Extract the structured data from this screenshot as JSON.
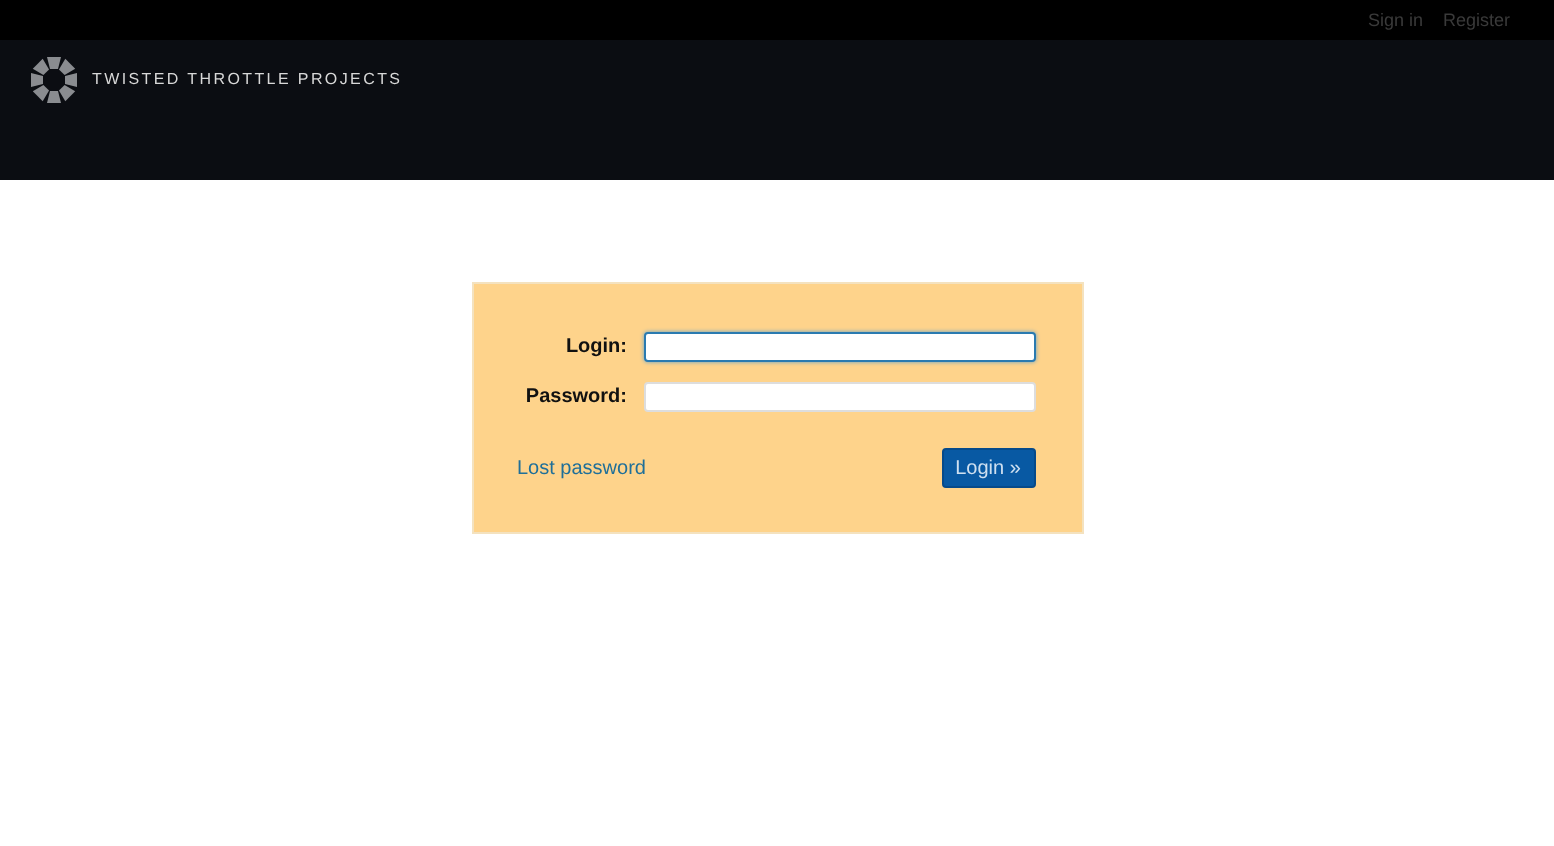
{
  "top_menu": [
    {
      "label": "Sign in"
    },
    {
      "label": "Register"
    }
  ],
  "header": {
    "title": "TWISTED THROTTLE PROJECTS"
  },
  "login_form": {
    "fields": [
      {
        "label": "Login:",
        "focused": true
      },
      {
        "label": "Password:",
        "focused": false
      }
    ],
    "lost_password_link": "Lost password",
    "submit_button": "Login »"
  }
}
